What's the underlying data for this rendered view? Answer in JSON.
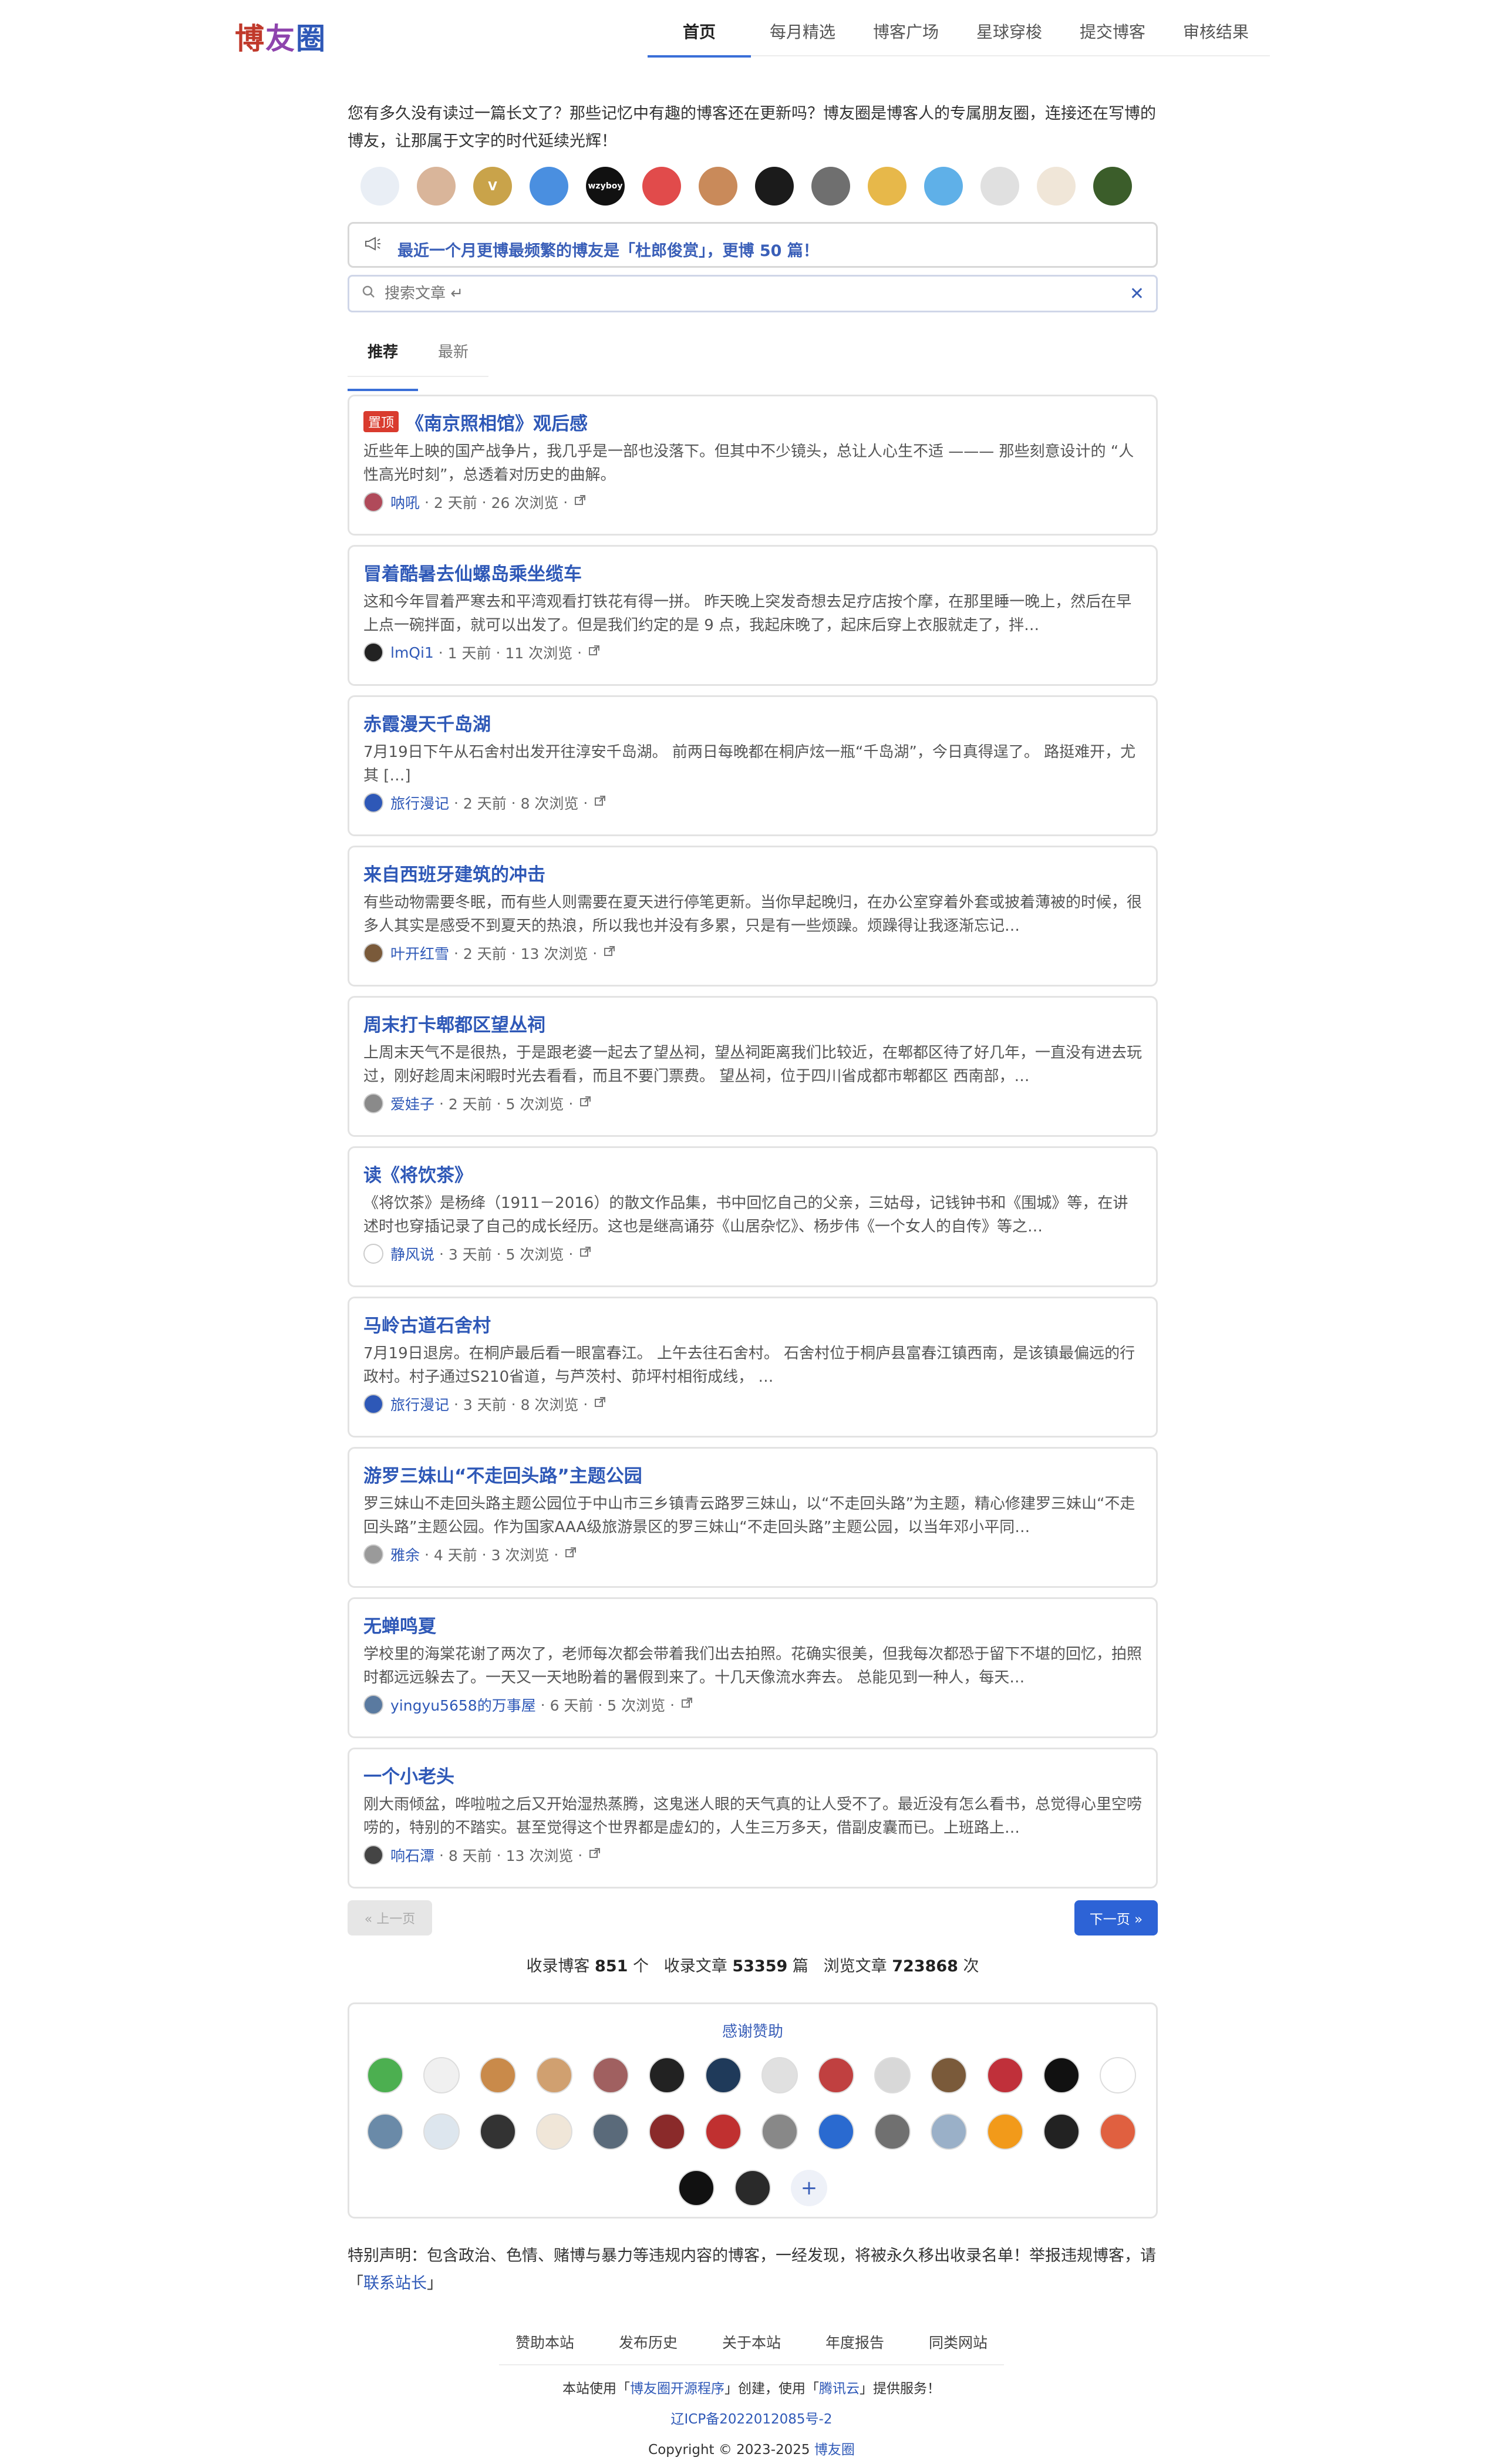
{
  "site": {
    "logo_chars": [
      "博",
      "友",
      "圈"
    ],
    "logo_colors": [
      "#c0392b",
      "#8e44ad",
      "#2e58b7"
    ]
  },
  "nav": {
    "items": [
      "首页",
      "每月精选",
      "博客广场",
      "星球穿梭",
      "提交博客",
      "审核结果"
    ],
    "active_index": 0
  },
  "intro": "您有多久没有读过一篇长文了？那些记忆中有趣的博客还在更新吗？博友圈是博客人的专属朋友圈，连接还在写博的博友，让那属于文字的时代延续光辉！",
  "top_avatars": [
    {
      "label": "",
      "color": "#e9eef5"
    },
    {
      "label": "",
      "color": "#d9b59a"
    },
    {
      "label": "V",
      "color": "#c9a34a"
    },
    {
      "label": "",
      "color": "#4a8fe0"
    },
    {
      "label": "wzyboy",
      "color": "#111111"
    },
    {
      "label": "",
      "color": "#e14b4b"
    },
    {
      "label": "",
      "color": "#c98a5a"
    },
    {
      "label": "",
      "color": "#1b1b1b"
    },
    {
      "label": "",
      "color": "#6f6f6f"
    },
    {
      "label": "",
      "color": "#e7b84a"
    },
    {
      "label": "",
      "color": "#5fb0e8"
    },
    {
      "label": "",
      "color": "#e0e0e0"
    },
    {
      "label": "",
      "color": "#f0e6d8"
    },
    {
      "label": "",
      "color": "#3b5d2a"
    }
  ],
  "notice": {
    "icon": "megaphone-icon",
    "text": "最近一个月更博最频繁的博友是「杜郎俊赏」，更博 50 篇！"
  },
  "search": {
    "placeholder": "搜索文章 ↵",
    "clear_icon": "close-icon"
  },
  "tabs": [
    "推荐",
    "最新"
  ],
  "posts": [
    {
      "pinned": true,
      "pin_label": "置顶",
      "title": "《南京照相馆》观后感",
      "summary": "近些年上映的国产战争片，我几乎是一部也没落下。但其中不少镜头，总让人心生不适 ——— 那些刻意设计的 “人性高光时刻”，总透着对历史的曲解。",
      "author": "呐吼",
      "time": "2 天前",
      "views": "26 次浏览",
      "avatar_color": "#b04a5a"
    },
    {
      "pinned": false,
      "title": "冒着酷暑去仙螺岛乘坐缆车",
      "summary": "这和今年冒着严寒去和平湾观看打铁花有得一拼。 昨天晚上突发奇想去足疗店按个摩，在那里睡一晚上，然后在早上点一碗拌面，就可以出发了。但是我们约定的是 9 点，我起床晚了，起床后穿上衣服就走了，拌…",
      "author": "lmQi1",
      "time": "1 天前",
      "views": "11 次浏览",
      "avatar_color": "#222222"
    },
    {
      "pinned": false,
      "title": "赤霞漫天千岛湖",
      "summary": "7月19日下午从石舍村出发开往淳安千岛湖。 前两日每晚都在桐庐炫一瓶“千岛湖”，今日真得逞了。 路挺难开，尤其 […]",
      "author": "旅行漫记",
      "time": "2 天前",
      "views": "8 次浏览",
      "avatar_color": "#2e58b7"
    },
    {
      "pinned": false,
      "title": "来自西班牙建筑的冲击",
      "summary": "有些动物需要冬眠，而有些人则需要在夏天进行停笔更新。当你早起晚归，在办公室穿着外套或披着薄被的时候，很多人其实是感受不到夏天的热浪，所以我也并没有多累，只是有一些烦躁。烦躁得让我逐渐忘记…",
      "author": "叶开红雪",
      "time": "2 天前",
      "views": "13 次浏览",
      "avatar_color": "#7a5a3a"
    },
    {
      "pinned": false,
      "title": "周末打卡郫都区望丛祠",
      "summary": "上周末天气不是很热，于是跟老婆一起去了望丛祠，望丛祠距离我们比较近，在郫都区待了好几年，一直没有进去玩过，刚好趁周末闲暇时光去看看，而且不要门票费。 望丛祠，位于四川省成都市郫都区 西南部，…",
      "author": "爱娃子",
      "time": "2 天前",
      "views": "5 次浏览",
      "avatar_color": "#8a8a8a"
    },
    {
      "pinned": false,
      "title": "读《将饮茶》",
      "summary": "《将饮茶》是杨绛（1911－2016）的散文作品集，书中回忆自己的父亲，三姑母，记钱钟书和《围城》等，在讲述时也穿插记录了自己的成长经历。这也是继高诵芬《山居杂忆》、杨步伟《一个女人的自传》等之…",
      "author": "静风说",
      "time": "3 天前",
      "views": "5 次浏览",
      "avatar_color": "#ffffff"
    },
    {
      "pinned": false,
      "title": "马岭古道石舍村",
      "summary": "7月19日退房。在桐庐最后看一眼富春江。 上午去往石舍村。 石舍村位于桐庐县富春江镇西南，是该镇最偏远的行政村。村子通过S210省道，与芦茨村、茆坪村相衔成线， …",
      "author": "旅行漫记",
      "time": "3 天前",
      "views": "8 次浏览",
      "avatar_color": "#2e58b7"
    },
    {
      "pinned": false,
      "title": "游罗三妹山“不走回头路”主题公园",
      "summary": "罗三妹山不走回头路主题公园位于中山市三乡镇青云路罗三妹山，以“不走回头路”为主题，精心修建罗三妹山“不走回头路”主题公园。作为国家AAA级旅游景区的罗三妹山“不走回头路”主题公园，以当年邓小平同…",
      "author": "雅余",
      "time": "4 天前",
      "views": "3 次浏览",
      "avatar_color": "#9a9a9a"
    },
    {
      "pinned": false,
      "title": "无蝉鸣夏",
      "summary": "学校里的海棠花谢了两次了，老师每次都会带着我们出去拍照。花确实很美，但我每次都恐于留下不堪的回忆，拍照时都远远躲去了。一天又一天地盼着的暑假到来了。十几天像流水奔去。 总能见到一种人，每天…",
      "author": "yingyu5658的万事屋",
      "time": "6 天前",
      "views": "5 次浏览",
      "avatar_color": "#5a7aa0"
    },
    {
      "pinned": false,
      "title": "一个小老头",
      "summary": "刚大雨倾盆，哗啦啦之后又开始湿热蒸腾，这鬼迷人眼的天气真的让人受不了。最近没有怎么看书，总觉得心里空唠唠的，特别的不踏实。甚至觉得这个世界都是虚幻的，人生三万多天，借副皮囊而已。上班路上…",
      "author": "响石潭",
      "time": "8 天前",
      "views": "13 次浏览",
      "avatar_color": "#444444"
    }
  ],
  "pager": {
    "prev": "« 上一页",
    "next": "下一页 »"
  },
  "stats": {
    "label_bloggers": "收录博客",
    "bloggers": "851",
    "unit_bloggers": "个",
    "label_articles": "收录文章",
    "articles": "53359",
    "unit_articles": "篇",
    "label_views": "浏览文章",
    "views": "723868",
    "unit_views": "次"
  },
  "sponsors": {
    "title": "感谢赞助",
    "row1_colors": [
      "#4caf50",
      "#f0f0f0",
      "#c98a4a",
      "#d0a070",
      "#a06060",
      "#222222",
      "#1f3a5a",
      "#e0e0e0",
      "#c04040",
      "#d8d8d8",
      "#7a5a3a",
      "#c0303a",
      "#111111",
      "#ffffff"
    ],
    "row2_colors": [
      "#6a8aa8",
      "#dde6ee",
      "#333333",
      "#f0e6d8",
      "#5a6a7a",
      "#8a2a2a",
      "#c03030",
      "#888888",
      "#2a6ad0",
      "#707070",
      "#9ab0c8",
      "#f29a1a",
      "#222222",
      "#e06040"
    ],
    "row3_colors": [
      "#111111",
      "#2a2a2a"
    ],
    "add_label": "+"
  },
  "disclaimer": {
    "text": "特别声明：包含政治、色情、赌博与暴力等违规内容的博客，一经发现，将被永久移出收录名单！举报违规博客，请「",
    "link": "联系站长",
    "end": "」"
  },
  "footer": {
    "links": [
      "赞助本站",
      "发布历史",
      "关于本站",
      "年度报告",
      "同类网站"
    ],
    "info_pre": "本站使用「",
    "info_link1": "博友圈开源程序",
    "info_mid": "」创建，使用「",
    "info_link2": "腾讯云",
    "info_post": "」提供服务！",
    "icp": "辽ICP备2022012085号-2",
    "copyright": "Copyright © 2023-2025",
    "copyright_link": "博友圈"
  }
}
